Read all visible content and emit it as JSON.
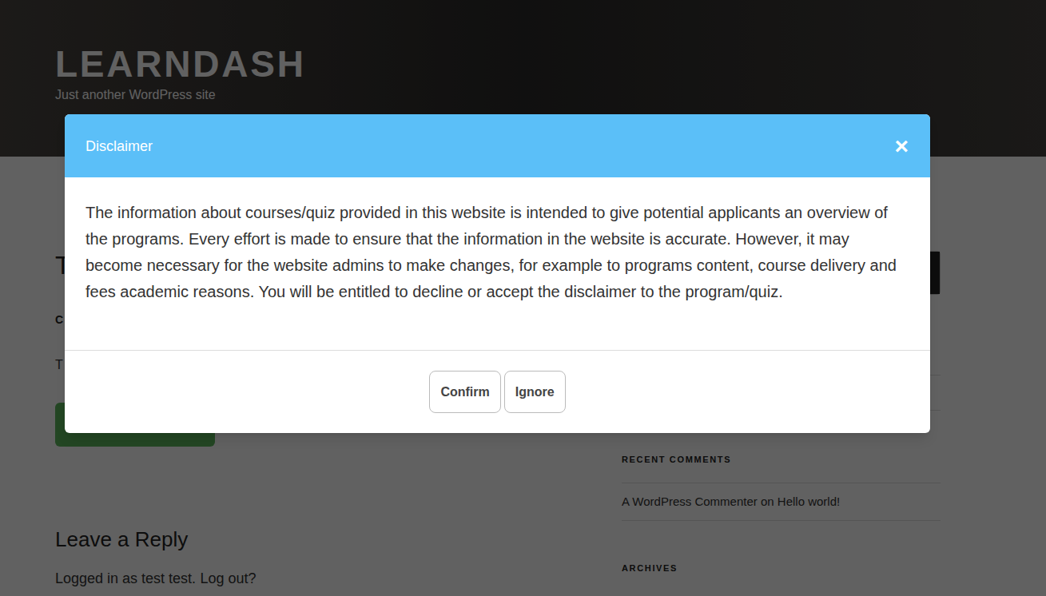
{
  "site": {
    "title": "LEARNDASH",
    "tagline": "Just another WordPress site"
  },
  "post": {
    "title": "T",
    "meta": "C",
    "excerpt": "T"
  },
  "comment_form": {
    "title": "Leave a Reply",
    "logged_in": "Logged in as test test.",
    "logout_link": "Log out?"
  },
  "sidebar": {
    "recent_comments_title": "RECENT COMMENTS",
    "recent_comments": [
      "A WordPress Commenter on Hello world!"
    ],
    "archives_title": "ARCHIVES"
  },
  "modal": {
    "title": "Disclaimer",
    "close": "×",
    "body": "The information about courses/quiz provided in this website is intended to give potential applicants an overview of the programs. Every effort is made to ensure that the information in the website is accurate. However, it may become necessary for the website admins to make changes, for example to programs content, course delivery and fees academic reasons. You will be entitled to decline or accept the disclaimer to the program/quiz.",
    "buttons": [
      "Confirm",
      "Ignore"
    ]
  }
}
